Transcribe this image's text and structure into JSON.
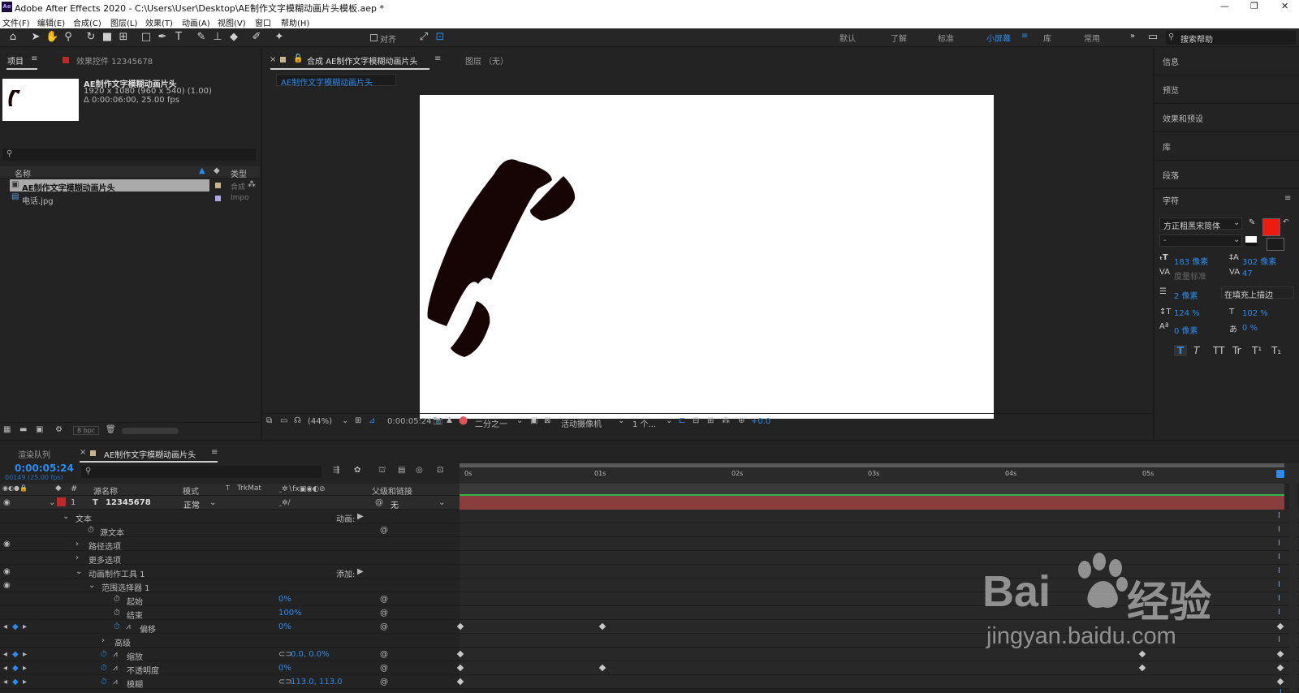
{
  "titlebar": {
    "title": "Adobe After Effects 2020 - C:\\Users\\User\\Desktop\\AE制作文字模糊动画片头模板.aep *",
    "minimize": "—",
    "maximize": "❐",
    "close": "✕"
  },
  "menu": [
    "文件(F)",
    "编辑(E)",
    "合成(C)",
    "图层(L)",
    "效果(T)",
    "动画(A)",
    "视图(V)",
    "窗口",
    "帮助(H)"
  ],
  "toolbar": {
    "align_label": "对齐",
    "workspaces": [
      "默认",
      "了解",
      "标准",
      "小屏幕",
      "库",
      "常用"
    ],
    "active_workspace": "小屏幕",
    "search_placeholder": "搜索帮助"
  },
  "project": {
    "tab": "项目",
    "effects_tab": "效果控件 12345678",
    "comp_name": "AE制作文字模糊动画片头",
    "comp_info1": "1920 x 1080  (960 x 540) (1.00)",
    "comp_info2": "Δ 0:00:06:00, 25.00 fps",
    "col_name": "名称",
    "col_type": "类型",
    "items": [
      {
        "name": "AE制作文字模糊动画片头",
        "type": "合成",
        "selected": true
      },
      {
        "name": "电话.jpg",
        "type": "Impo"
      }
    ],
    "bpc": "8 bpc"
  },
  "comp": {
    "tab": "合成 AE制作文字模糊动画片头",
    "layer_tab": "图层 （无）",
    "breadcrumb": "AE制作文字模糊动画片头",
    "zoom": "(44%)",
    "timecode": "0:00:05:24",
    "resolution": "二分之一",
    "camera": "活动摄像机",
    "views": "1 个...",
    "exposure": "+0.0"
  },
  "right": {
    "panels": [
      "信息",
      "预览",
      "效果和预设",
      "库",
      "段落"
    ],
    "char_title": "字符",
    "font_family": "方正粗黑宋简体",
    "font_style": "-",
    "font_size": "183 像素",
    "leading": "302 像素",
    "kerning": "度量标准",
    "tracking": "47",
    "stroke_width": "2 像素",
    "stroke_type": "在填充上描边",
    "vscale": "124 %",
    "hscale": "102 %",
    "baseline": "0 像素",
    "tsume": "0 %",
    "fill_color": "#ee1c10",
    "styles": [
      "T",
      "T",
      "TT",
      "Tr",
      "T¹",
      "T₁"
    ]
  },
  "timeline": {
    "render_tab": "渲染队列",
    "comp_tab": "AE制作文字模糊动画片头",
    "timecode": "0:00:05:24",
    "frame": "00149 (25.00 fps)",
    "col_source": "源名称",
    "col_mode": "模式",
    "col_t": "T",
    "col_trkmat": "TrkMat",
    "col_parent": "父级和链接",
    "layer_num": "1",
    "layer_name": "12345678",
    "layer_mode": "正常",
    "parent": "无",
    "ruler": [
      "0s",
      "01s",
      "02s",
      "03s",
      "04s",
      "05s"
    ],
    "props": [
      {
        "label": "文本",
        "value": "",
        "extra": "动画:"
      },
      {
        "label": "源文本",
        "value": ""
      },
      {
        "label": "路径选项",
        "value": ""
      },
      {
        "label": "更多选项",
        "value": ""
      },
      {
        "label": "动画制作工具 1",
        "value": "",
        "extra": "添加:"
      },
      {
        "label": "范围选择器 1",
        "value": ""
      },
      {
        "label": "起始",
        "value": "0%"
      },
      {
        "label": "结束",
        "value": "100%"
      },
      {
        "label": "偏移",
        "value": "0%"
      },
      {
        "label": "高级",
        "value": ""
      },
      {
        "label": "缩放",
        "value": "0.0, 0.0%"
      },
      {
        "label": "不透明度",
        "value": "0%"
      },
      {
        "label": "模糊",
        "value": "113.0, 113.0"
      }
    ]
  },
  "watermark": {
    "brand": "Bai",
    "brand2": "经验",
    "url": "jingyan.baidu.com"
  }
}
